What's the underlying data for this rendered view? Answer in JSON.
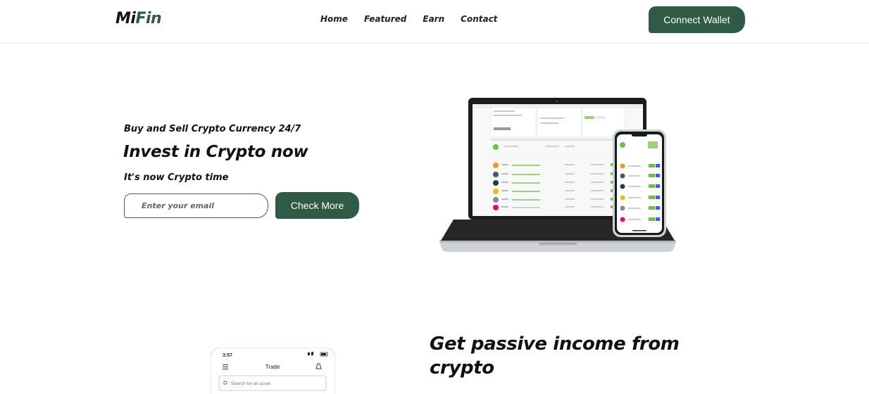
{
  "brand": {
    "logo_part1": "Mi",
    "logo_part2": "Fin"
  },
  "nav": {
    "items": [
      "Home",
      "Featured",
      "Earn",
      "Contact"
    ]
  },
  "header": {
    "connect_label": "Connect Wallet"
  },
  "hero": {
    "tagline": "Buy and Sell Crypto Currency 24/7",
    "headline": "Invest in Crypto now",
    "subline": "It's now Crypto time",
    "email_placeholder": "Enter your email",
    "cta_label": "Check More"
  },
  "passive": {
    "title_line1": "Get passive income from",
    "title_line2": "crypto"
  },
  "phone_preview": {
    "time": "3:57",
    "screen_title": "Trade",
    "search_placeholder": "Search for an asset"
  },
  "colors": {
    "brand_green": "#2f5a46",
    "text": "#111111",
    "border": "#ececec"
  }
}
